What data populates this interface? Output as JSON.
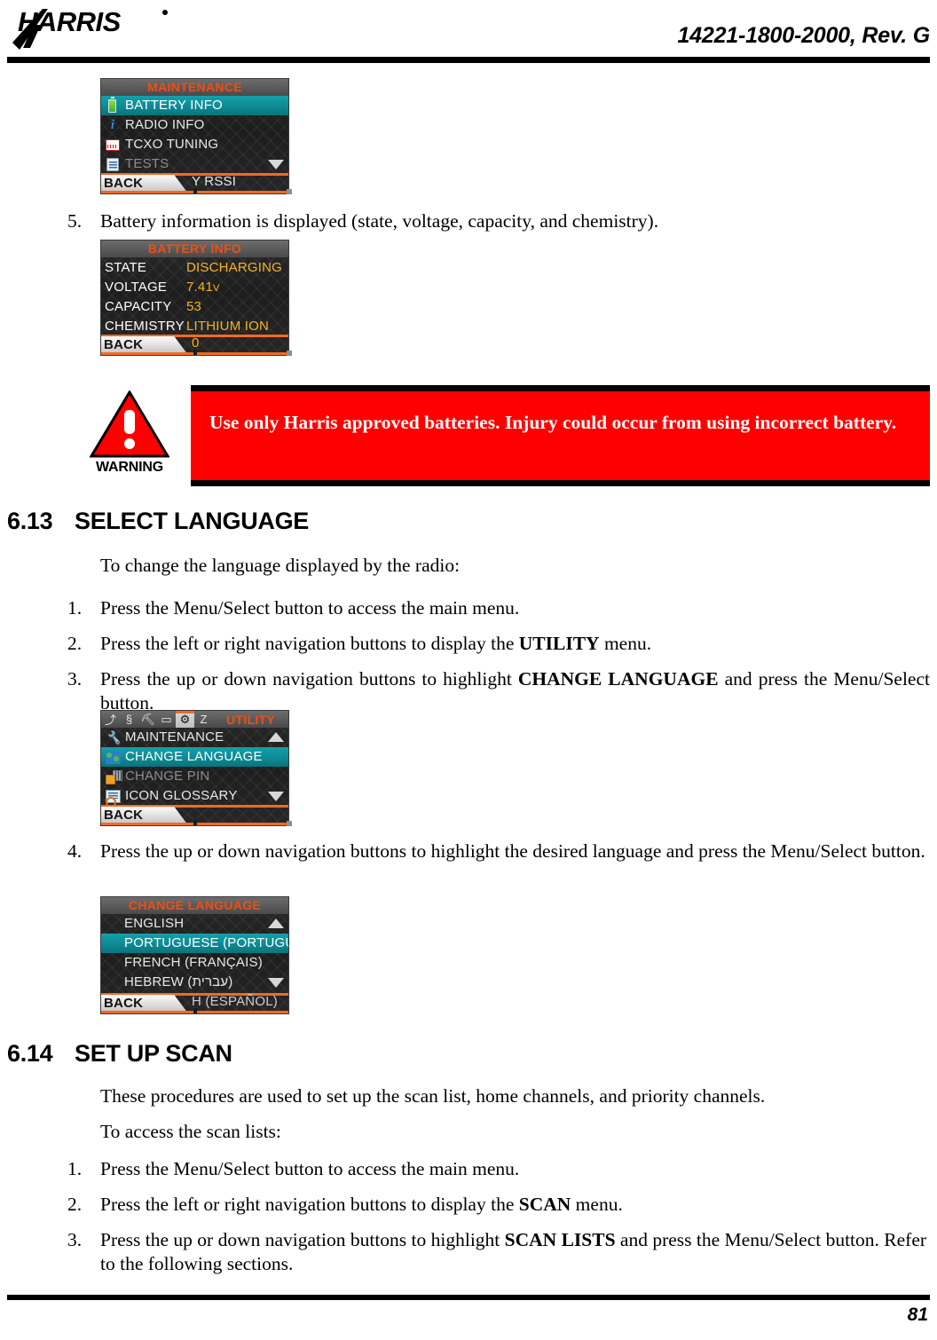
{
  "header": {
    "logo_text": "HARRIS",
    "doc_number": "14221-1800-2000, Rev. G"
  },
  "footer": {
    "page_number": "81"
  },
  "colors": {
    "warning_red": "#ff0000",
    "screen_highlight_teal": "#0d8a94",
    "screen_title_orange": "#f04e14",
    "screen_value_amber": "#f5b324",
    "softkey_bar_orange": "#f26a21"
  },
  "step5": {
    "number": "5.",
    "text": "Battery information is displayed (state, voltage, capacity, and chemistry)."
  },
  "maintenance_screen": {
    "title": "MAINTENANCE",
    "rows": [
      {
        "label": "BATTERY INFO",
        "icon": "battery-icon",
        "selected": true,
        "dim": false
      },
      {
        "label": "RADIO INFO",
        "icon": "info-icon",
        "selected": false,
        "dim": false
      },
      {
        "label": "TCXO TUNING",
        "icon": "tcxo-icon",
        "selected": false,
        "dim": false
      },
      {
        "label": "TESTS",
        "icon": "tests-icon",
        "selected": false,
        "dim": true
      }
    ],
    "scroll_down": true,
    "softkey_back": "BACK",
    "partial_row": "Y RSSI"
  },
  "battery_info_screen": {
    "title": "BATTERY INFO",
    "rows": [
      {
        "key": "STATE",
        "value": "DISCHARGING",
        "unit": ""
      },
      {
        "key": "VOLTAGE",
        "value": "7.41",
        "unit": "V"
      },
      {
        "key": "CAPACITY",
        "value": "53",
        "unit": ""
      },
      {
        "key": "CHEMISTRY",
        "value": "LITHIUM ION",
        "unit": ""
      }
    ],
    "softkey_back": "BACK",
    "partial_row": "0"
  },
  "warning": {
    "label": "WARNING",
    "text": "Use only Harris approved batteries. Injury could occur from using incorrect battery."
  },
  "section_language": {
    "number": "6.13",
    "title": "SELECT LANGUAGE",
    "intro": "To change the language displayed by the radio:",
    "steps": [
      {
        "number": "1.",
        "text": "Press the Menu/Select button to access the main menu."
      },
      {
        "number": "2.",
        "text_pre": "Press the left or right navigation buttons to display the ",
        "bold": "UTILITY",
        "text_post": " menu."
      },
      {
        "number": "3.",
        "text_pre": "Press the up or down navigation buttons to highlight ",
        "bold": "CHANGE LANGUAGE",
        "text_post": " and press the Menu/Select button."
      },
      {
        "number": "4.",
        "text": "Press the up or down navigation buttons to highlight the desired language and press the Menu/Select button."
      }
    ]
  },
  "utility_screen": {
    "title": "UTILITY",
    "tabs": [
      {
        "icon": "phone-hook-icon",
        "glyph": "⤴",
        "selected": false
      },
      {
        "icon": "section-sign-icon",
        "glyph": "§",
        "selected": false
      },
      {
        "icon": "wrench-icon",
        "glyph": "⛏",
        "selected": false
      },
      {
        "icon": "speech-bubble-icon",
        "glyph": "▭",
        "selected": false
      },
      {
        "icon": "gear-icon",
        "glyph": "⚙",
        "selected": true
      },
      {
        "icon": "sleep-z-icon",
        "glyph": "Z",
        "selected": false
      }
    ],
    "rows": [
      {
        "label": "MAINTENANCE",
        "icon": "wrench-icon",
        "selected": false,
        "dim": false
      },
      {
        "label": "CHANGE LANGUAGE",
        "icon": "globe-icon",
        "selected": true,
        "dim": false
      },
      {
        "label": "CHANGE PIN",
        "icon": "pin-keypad-icon",
        "selected": false,
        "dim": true
      },
      {
        "label": "ICON GLOSSARY",
        "icon": "glossary-icon",
        "selected": false,
        "dim": false
      }
    ],
    "scroll_up": true,
    "scroll_down": true,
    "softkey_back": "BACK"
  },
  "change_language_screen": {
    "title": "CHANGE LANGUAGE",
    "rows": [
      {
        "label": "ENGLISH",
        "selected": false
      },
      {
        "label": "PORTUGUESE (PORTUGUÊS)",
        "selected": true
      },
      {
        "label": "FRENCH (FRANÇAIS)",
        "selected": false
      },
      {
        "label": "HEBREW (עברית)",
        "selected": false
      }
    ],
    "scroll_up": true,
    "scroll_down": true,
    "softkey_back": "BACK",
    "partial_row": "H (ESPAÑOL)"
  },
  "section_scan": {
    "number": "6.14",
    "title": "SET UP SCAN",
    "intro1": "These procedures are used to set up the scan list, home channels, and priority channels.",
    "intro2": "To access the scan lists:",
    "steps": [
      {
        "number": "1.",
        "text": "Press the Menu/Select button to access the main menu."
      },
      {
        "number": "2.",
        "text_pre": "Press the left or right navigation buttons to display the ",
        "bold": "SCAN",
        "text_post": " menu."
      },
      {
        "number": "3.",
        "text_pre": "Press the up or down navigation buttons to highlight ",
        "bold": "SCAN LISTS",
        "text_post": " and press the Menu/Select button. Refer to the following sections."
      }
    ]
  }
}
